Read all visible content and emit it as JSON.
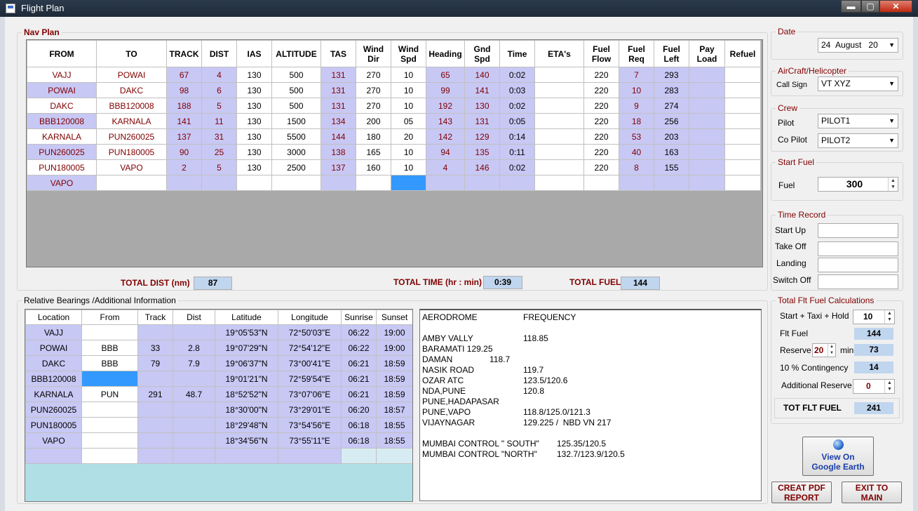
{
  "window": {
    "title": "Flight Plan",
    "min": "▬",
    "max": "▢",
    "close": "✕"
  },
  "navplan": {
    "label": "Nav Plan",
    "headers": [
      "FROM",
      "TO",
      "TRACK",
      "DIST",
      "IAS",
      "ALTITUDE",
      "TAS",
      "Wind Dir",
      "Wind Spd",
      "Heading",
      "Gnd Spd",
      "Time",
      "ETA's",
      "Fuel Flow",
      "Fuel Req",
      "Fuel Left",
      "Pay Load",
      "Refuel"
    ],
    "rows": [
      [
        "VAJJ",
        "POWAI",
        "67",
        "4",
        "130",
        "500",
        "131",
        "270",
        "10",
        "65",
        "140",
        "0:02",
        "",
        "220",
        "7",
        "293",
        "",
        ""
      ],
      [
        "POWAI",
        "DAKC",
        "98",
        "6",
        "130",
        "500",
        "131",
        "270",
        "10",
        "99",
        "141",
        "0:03",
        "",
        "220",
        "10",
        "283",
        "",
        ""
      ],
      [
        "DAKC",
        "BBB120008",
        "188",
        "5",
        "130",
        "500",
        "131",
        "270",
        "10",
        "192",
        "130",
        "0:02",
        "",
        "220",
        "9",
        "274",
        "",
        ""
      ],
      [
        "BBB120008",
        "KARNALA",
        "141",
        "11",
        "130",
        "1500",
        "134",
        "200",
        "05",
        "143",
        "131",
        "0:05",
        "",
        "220",
        "18",
        "256",
        "",
        ""
      ],
      [
        "KARNALA",
        "PUN260025",
        "137",
        "31",
        "130",
        "5500",
        "144",
        "180",
        "20",
        "142",
        "129",
        "0:14",
        "",
        "220",
        "53",
        "203",
        "",
        ""
      ],
      [
        "PUN260025",
        "PUN180005",
        "90",
        "25",
        "130",
        "3000",
        "138",
        "165",
        "10",
        "94",
        "135",
        "0:11",
        "",
        "220",
        "40",
        "163",
        "",
        ""
      ],
      [
        "PUN180005",
        "VAPO",
        "2",
        "5",
        "130",
        "2500",
        "137",
        "160",
        "10",
        "4",
        "146",
        "0:02",
        "",
        "220",
        "8",
        "155",
        "",
        ""
      ],
      [
        "VAPO",
        "",
        "",
        "",
        "",
        "",
        "",
        "",
        "",
        "",
        "",
        "",
        "",
        "",
        "",
        "",
        "",
        ""
      ]
    ]
  },
  "totals": {
    "dist_label": "TOTAL DIST (nm)",
    "dist": "87",
    "time_label": "TOTAL TIME (hr : min)",
    "time": "0:39",
    "fuel_label": "TOTAL FUEL",
    "fuel": "144"
  },
  "relative": {
    "label": "Relative Bearings /Additional Information",
    "headers": [
      "Location",
      "From",
      "Track",
      "Dist",
      "Latitude",
      "Longitude",
      "Sunrise",
      "Sunset"
    ],
    "rows": [
      [
        "VAJJ",
        "",
        "",
        "",
        "19°05'53\"N",
        "72°50'03\"E",
        "06:22",
        "19:00"
      ],
      [
        "POWAI",
        "BBB",
        "33",
        "2.8",
        "19°07'29\"N",
        "72°54'12\"E",
        "06:22",
        "19:00"
      ],
      [
        "DAKC",
        "BBB",
        "79",
        "7.9",
        "19°06'37\"N",
        "73°00'41\"E",
        "06:21",
        "18:59"
      ],
      [
        "BBB120008",
        "",
        "",
        "",
        "19°01'21\"N",
        "72°59'54\"E",
        "06:21",
        "18:59"
      ],
      [
        "KARNALA",
        "PUN",
        "291",
        "48.7",
        "18°52'52\"N",
        "73°07'06\"E",
        "06:21",
        "18:59"
      ],
      [
        "PUN260025",
        "",
        "",
        "",
        "18°30'00\"N",
        "73°29'01\"E",
        "06:20",
        "18:57"
      ],
      [
        "PUN180005",
        "",
        "",
        "",
        "18°29'48\"N",
        "73°54'56\"E",
        "06:18",
        "18:55"
      ],
      [
        "VAPO",
        "",
        "",
        "",
        "18°34'56\"N",
        "73°55'11\"E",
        "06:18",
        "18:55"
      ],
      [
        "",
        "",
        "",
        "",
        "",
        "",
        "",
        ""
      ]
    ]
  },
  "frequencies": [
    {
      "name": "AERODROME",
      "value": "FREQUENCY"
    },
    {
      "name": "",
      "value": ""
    },
    {
      "name": "AMBY VALLY",
      "value": "118.85"
    },
    {
      "name": "BARAMATI 129.25",
      "value": ""
    },
    {
      "name": "DAMAN",
      "value": "118.7",
      "indent": "short"
    },
    {
      "name": "NASIK ROAD",
      "value": "119.7"
    },
    {
      "name": "OZAR ATC",
      "value": "123.5/120.6"
    },
    {
      "name": "NDA,PUNE",
      "value": "120.8"
    },
    {
      "name": "PUNE,HADAPASAR",
      "value": ""
    },
    {
      "name": "PUNE,VAPO",
      "value": "118.8/125.0/121.3"
    },
    {
      "name": "VIJAYNAGAR",
      "value": "129.225 /  NBD VN 217"
    },
    {
      "name": "",
      "value": ""
    },
    {
      "name": "MUMBAI CONTROL \" SOUTH\"",
      "value": "125.35/120.5",
      "indent": "long"
    },
    {
      "name": "MUMBAI CONTROL \"NORTH\"",
      "value": "132.7/123.9/120.5",
      "indent": "long"
    }
  ],
  "date": {
    "label": "Date",
    "day": "24",
    "month": "August",
    "year": "20"
  },
  "aircraft": {
    "label": "AirCraft/Helicopter",
    "callsign_label": "Call Sign",
    "callsign": "VT XYZ"
  },
  "crew": {
    "label": "Crew",
    "pilot_label": "Pilot",
    "pilot": "PILOT1",
    "copilot_label": "Co Pilot",
    "copilot": "PILOT2"
  },
  "startfuel": {
    "label": "Start Fuel",
    "fuel_label": "Fuel",
    "fuel": "300"
  },
  "timerecord": {
    "label": "Time Record",
    "startup": "Start Up",
    "takeoff": "Take Off",
    "landing": "Landing",
    "switchoff": "Switch Off"
  },
  "fuelcalc": {
    "label": "Total Flt Fuel Calculations",
    "sth_label": "Start + Taxi + Hold",
    "sth": "10",
    "flt_label": "Flt Fuel",
    "flt": "144",
    "reserve_label": "Reserve",
    "reserve_min": "20",
    "min_label": "min",
    "reserve": "73",
    "cont_label": "10 % Contingency",
    "cont": "14",
    "add_label": "Additional Reserve",
    "add": "0",
    "tot_label": "TOT FLT FUEL",
    "tot": "241"
  },
  "buttons": {
    "earth_line1": "View On",
    "earth_line2": "Google Earth",
    "pdf_line1": "CREAT PDF",
    "pdf_line2": "REPORT",
    "exit_line1": "EXIT TO",
    "exit_line2": "MAIN"
  }
}
